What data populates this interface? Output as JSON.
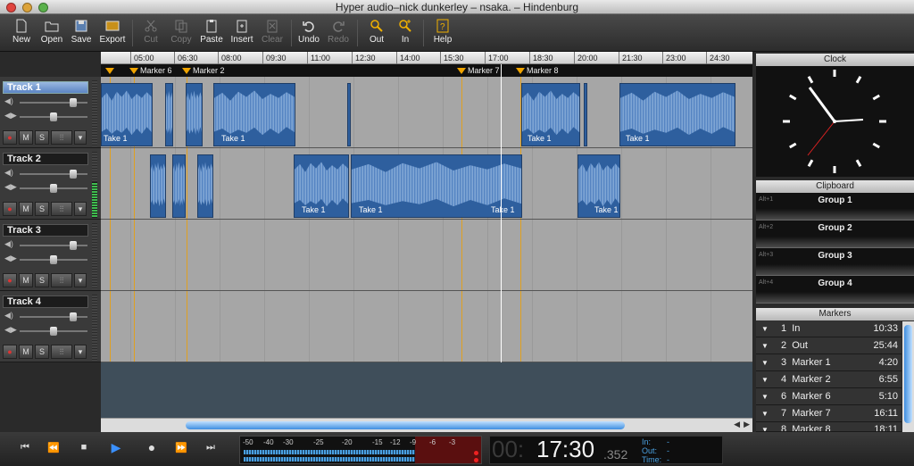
{
  "window": {
    "title": "Hyper audio–nick dunkerley – nsaka. – Hindenburg"
  },
  "toolbar": {
    "new": "New",
    "open": "Open",
    "save": "Save",
    "export": "Export",
    "cut": "Cut",
    "copy": "Copy",
    "paste": "Paste",
    "insert": "Insert",
    "clear": "Clear",
    "undo": "Undo",
    "redo": "Redo",
    "out": "Out",
    "in": "In",
    "help": "Help"
  },
  "ruler": {
    "ticks": [
      "05:00",
      "06:30",
      "08:00",
      "09:30",
      "11:00",
      "12:30",
      "14:00",
      "15:30",
      "17:00",
      "18:30",
      "20:00",
      "21:30",
      "23:00",
      "24:30"
    ]
  },
  "markers": {
    "m6": "Marker 6",
    "m2": "Marker 2",
    "m7": "Marker 7",
    "m8": "Marker 8"
  },
  "tracks": [
    {
      "name": "Track 1",
      "clip_label": "Take 1"
    },
    {
      "name": "Track 2",
      "clip_label": "Take 1"
    },
    {
      "name": "Track 3"
    },
    {
      "name": "Track 4"
    }
  ],
  "track_buttons": {
    "mute": "M",
    "solo": "S"
  },
  "panels": {
    "clock": "Clock",
    "clipboard": "Clipboard",
    "markers": "Markers"
  },
  "clipboard": [
    {
      "key": "Alt+1",
      "name": "Group 1"
    },
    {
      "key": "Alt+2",
      "name": "Group 2"
    },
    {
      "key": "Alt+3",
      "name": "Group 3"
    },
    {
      "key": "Alt+4",
      "name": "Group 4"
    }
  ],
  "marker_list": [
    {
      "num": "1",
      "name": "In",
      "time": "10:33"
    },
    {
      "num": "2",
      "name": "Out",
      "time": "25:44"
    },
    {
      "num": "3",
      "name": "Marker 1",
      "time": "4:20"
    },
    {
      "num": "4",
      "name": "Marker 2",
      "time": "6:55"
    },
    {
      "num": "6",
      "name": "Marker 6",
      "time": "5:10"
    },
    {
      "num": "7",
      "name": "Marker 7",
      "time": "16:11"
    },
    {
      "num": "8",
      "name": "Marker 8",
      "time": "18:11"
    }
  ],
  "meter_scale": [
    "-50",
    "-40",
    "-30",
    "-25",
    "-20",
    "-15",
    "-12",
    "-9",
    "-6",
    "-3"
  ],
  "timecode": {
    "dim": "00:",
    "main": "17:30",
    "ms": ".352",
    "in": "In:",
    "out": "Out:",
    "time": "Time:",
    "in_v": "-",
    "out_v": "-",
    "time_v": "-"
  },
  "colors": {
    "clip": "#2e5f9e",
    "marker": "#f0a400",
    "selected_track": "#5c85c4"
  }
}
